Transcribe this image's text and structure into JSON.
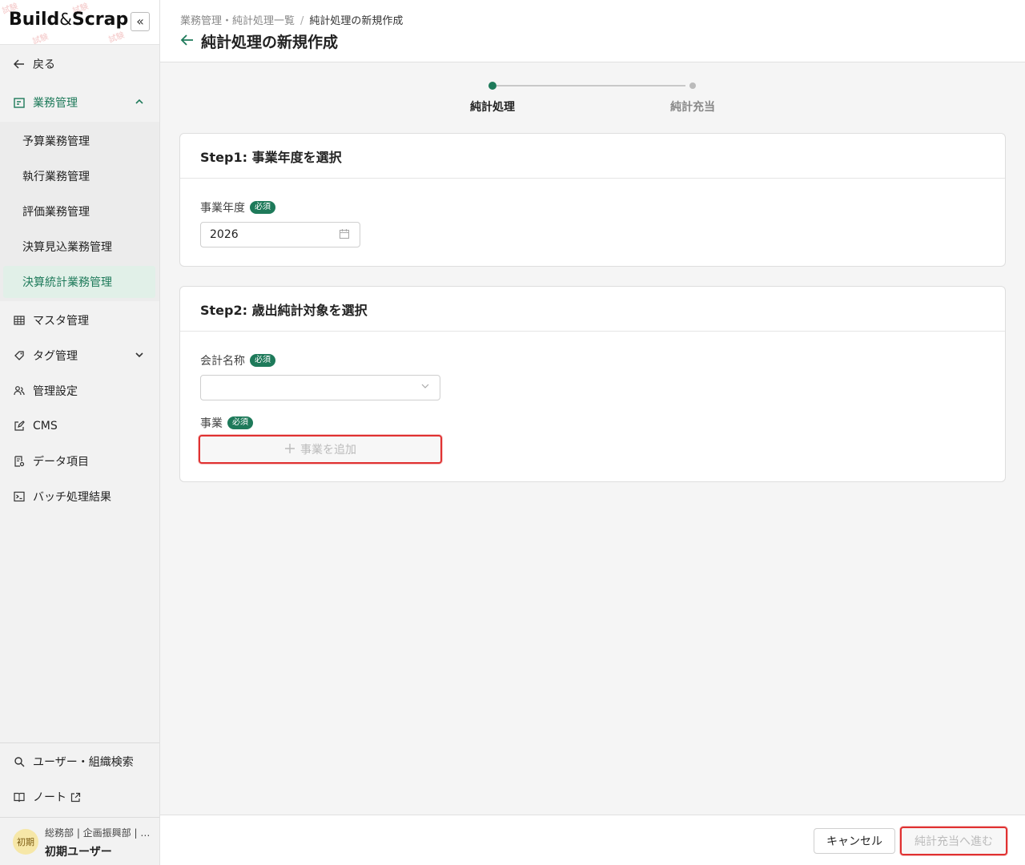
{
  "app": {
    "logo_main": "Build",
    "logo_amp": "&",
    "logo_tail": "Scrap",
    "collapse_glyph": "«"
  },
  "sidebar": {
    "back_label": "戻る",
    "group_label": "業務管理",
    "sub_items": [
      {
        "label": "予算業務管理"
      },
      {
        "label": "執行業務管理"
      },
      {
        "label": "評価業務管理"
      },
      {
        "label": "決算見込業務管理"
      },
      {
        "label": "決算統計業務管理"
      }
    ],
    "items": [
      {
        "label": "マスタ管理",
        "icon": "table-icon"
      },
      {
        "label": "タグ管理",
        "icon": "tag-icon"
      },
      {
        "label": "管理設定",
        "icon": "users-icon"
      },
      {
        "label": "CMS",
        "icon": "edit-icon"
      },
      {
        "label": "データ項目",
        "icon": "document-icon"
      },
      {
        "label": "バッチ処理結果",
        "icon": "terminal-icon"
      }
    ],
    "bottom_items": [
      {
        "label": "ユーザー・組織検索",
        "icon": "search-icon"
      },
      {
        "label": "ノート",
        "icon": "book-icon"
      }
    ],
    "user": {
      "avatar": "初期",
      "dept": "総務部 | 企画振興部 | …",
      "name": "初期ユーザー"
    }
  },
  "header": {
    "breadcrumb": [
      "業務管理・純計処理一覧",
      "純計処理の新規作成"
    ],
    "breadcrumb_sep": "/",
    "title": "純計処理の新規作成"
  },
  "stepper": {
    "steps": [
      {
        "label": "純計処理",
        "active": true
      },
      {
        "label": "純計充当",
        "active": false
      }
    ]
  },
  "step1": {
    "title": "Step1: 事業年度を選択",
    "field_label": "事業年度",
    "required": "必須",
    "value": "2026"
  },
  "step2": {
    "title": "Step2: 歳出純計対象を選択",
    "account_label": "会計名称",
    "project_label": "事業",
    "required": "必須",
    "add_button": "事業を追加"
  },
  "footer": {
    "cancel": "キャンセル",
    "next": "純計充当へ進む"
  },
  "colors": {
    "accent": "#1e7a5a",
    "highlight": "#e03131"
  }
}
